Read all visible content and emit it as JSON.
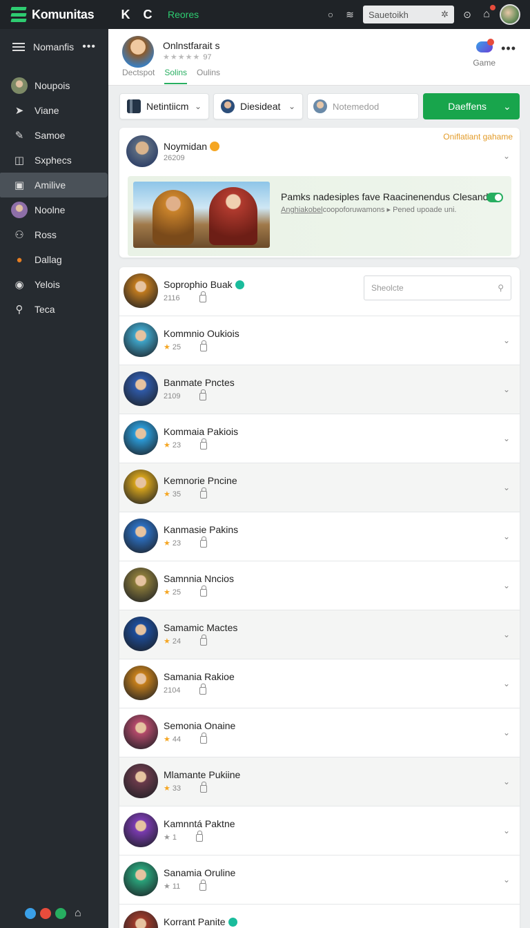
{
  "topbar": {
    "brand": "Komunitas",
    "nav_glyph_1": "K",
    "nav_glyph_2": "C",
    "nav_link": "Reores",
    "search_placeholder": "Sauetoikh"
  },
  "sidebar": {
    "header_label": "Nomanfis",
    "items": [
      {
        "label": "Noupois",
        "icon": "avatar",
        "color": "#7d8a66"
      },
      {
        "label": "Viane",
        "icon": "arrow-icon"
      },
      {
        "label": "Samoe",
        "icon": "pin-icon"
      },
      {
        "label": "Sxphecs",
        "icon": "book-icon"
      },
      {
        "label": "Amilive",
        "icon": "square-icon",
        "active": true
      },
      {
        "label": "Noolne",
        "icon": "avatar",
        "color": "#8e6fa8"
      },
      {
        "label": "Ross",
        "icon": "user-icon"
      },
      {
        "label": "Dallag",
        "icon": "ball-icon",
        "color": "#e67e22"
      },
      {
        "label": "Yelois",
        "icon": "target-icon"
      },
      {
        "label": "Teca",
        "icon": "search-icon"
      }
    ],
    "footer_colors": [
      "#3aa0e8",
      "#e74c3c",
      "#27ae60"
    ]
  },
  "profile": {
    "name": "Onlnstfarait s",
    "rating_num": "97",
    "tabs": [
      "Dectspot",
      "Solins",
      "Oulins"
    ],
    "active_tab": 1,
    "game_label": "Game"
  },
  "filters": {
    "select1": "Netintiicm",
    "select2": "Diesideat",
    "input_placeholder": "Notemedod",
    "primary_label": "Daeffens"
  },
  "featured": {
    "name": "Noymidan",
    "number": "26209",
    "note": "Oniflatiant gahame",
    "banner_title": "Pamks nadesiples fave Raacinenendus Clesand",
    "banner_sub_1": "Anghiakobel",
    "banner_sub_2": "coopoforuwamons",
    "banner_sub_3": "Pened upoade uni.",
    "toggle_on": true
  },
  "list": {
    "search_placeholder": "Sheolcte",
    "rows": [
      {
        "name": "Soprophio Buak",
        "meta": "2116",
        "star": false,
        "badge": true,
        "color": "#c07a1e"
      },
      {
        "name": "Kommnio Oukiois",
        "meta": "25",
        "star": true,
        "badge": false,
        "color": "#3fa4c8"
      },
      {
        "name": "Banmate Pnctes",
        "meta": "2109",
        "star": false,
        "badge": false,
        "color": "#2f5aa8",
        "shade": true
      },
      {
        "name": "Kommaia Pakiois",
        "meta": "23",
        "star": true,
        "badge": false,
        "color": "#2b9ad6"
      },
      {
        "name": "Kemnorie Pncine",
        "meta": "35",
        "star": true,
        "badge": false,
        "color": "#d4a21c",
        "shade": true
      },
      {
        "name": "Kanmasie Pakins",
        "meta": "23",
        "star": true,
        "badge": false,
        "color": "#2c6fc0"
      },
      {
        "name": "Samnnia Nncios",
        "meta": "25",
        "star": true,
        "badge": false,
        "color": "#8a7a3a"
      },
      {
        "name": "Samamic Mactes",
        "meta": "24",
        "star": true,
        "badge": false,
        "color": "#1d4d9a",
        "shade": true
      },
      {
        "name": "Samania Rakioe",
        "meta": "2104",
        "star": false,
        "badge": false,
        "color": "#c57f1b"
      },
      {
        "name": "Semonia Onaine",
        "meta": "44",
        "star": true,
        "badge": false,
        "color": "#b34a6a"
      },
      {
        "name": "Mlamante Pukiine",
        "meta": "33",
        "star": true,
        "badge": false,
        "color": "#6a3a4a",
        "shade": true
      },
      {
        "name": "Kamnntá Paktne",
        "meta": "1",
        "star": true,
        "star_grey": true,
        "badge": false,
        "color": "#7a3bb0"
      },
      {
        "name": "Sanamia Oruline",
        "meta": "11",
        "star": true,
        "star_grey": true,
        "badge": false,
        "color": "#2aa37a"
      },
      {
        "name": "Korrant Panite",
        "meta": "",
        "star": false,
        "badge": true,
        "color": "#9b3a2a"
      }
    ]
  }
}
